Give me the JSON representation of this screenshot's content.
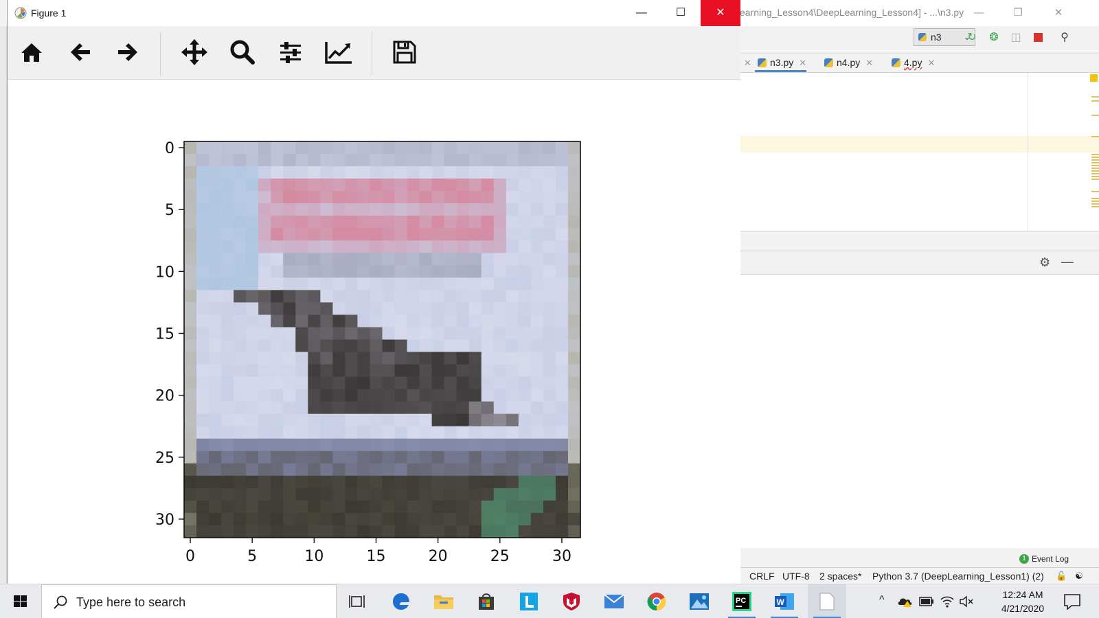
{
  "ide": {
    "window_title": "earning_Lesson4\\DeepLearning_Lesson4] - ...\\n3.py",
    "run_config": "n3",
    "tabs": [
      {
        "label": "n3.py",
        "active": true
      },
      {
        "label": "n4.py",
        "active": false
      },
      {
        "label": "4.py",
        "active": false
      }
    ],
    "event_log": "Event Log",
    "event_log_count": "1",
    "status": {
      "line_sep": "CRLF",
      "encoding": "UTF-8",
      "indent": "2 spaces*",
      "interpreter": "Python 3.7 (DeepLearning_Lesson1) (2)"
    }
  },
  "figure": {
    "title": "Figure 1",
    "toolbar": [
      "home",
      "back",
      "forward",
      "pan",
      "zoom",
      "configure-subplots",
      "edit-axis",
      "save"
    ],
    "close_color": "#e81123"
  },
  "chart_data": {
    "type": "heatmap",
    "title": "",
    "xlabel": "",
    "ylabel": "",
    "xlim": [
      -0.5,
      31.5
    ],
    "ylim": [
      31.5,
      -0.5
    ],
    "xticks": [
      "0",
      "5",
      "10",
      "15",
      "20",
      "25",
      "30"
    ],
    "yticks": [
      "0",
      "5",
      "10",
      "15",
      "20",
      "25",
      "30"
    ],
    "rows": 32,
    "cols": 32,
    "description_palette": {
      "sky": "#c9cfe6",
      "sky_light": "#d6d9ec",
      "pink_banner": "#d58aa0",
      "pink_light": "#cfa9c0",
      "banner_shadow": "#a9acc2",
      "plane_dark": "#3c3838",
      "plane_mid": "#6a6468",
      "plane_light": "#9a9aa4",
      "strip": "#777a96",
      "strip_light": "#8a8fb0",
      "ground": "#3c3a32",
      "ground_light": "#55524a",
      "green": "#4f7f66",
      "border": "#b0ad98"
    }
  },
  "taskbar": {
    "search_placeholder": "Type here to search",
    "time": "12:24 AM",
    "date": "4/21/2020",
    "apps": [
      "task-view",
      "edge",
      "file-explorer",
      "store",
      "l-app",
      "mcafee",
      "mail",
      "chrome",
      "photos",
      "pycharm",
      "word",
      "notepad"
    ]
  }
}
